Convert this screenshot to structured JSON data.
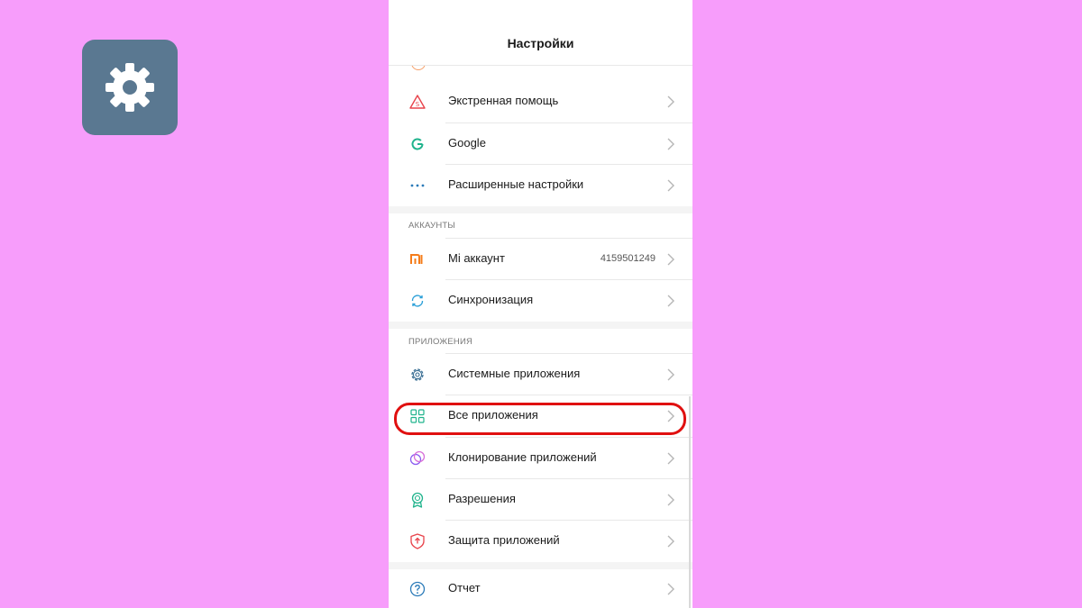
{
  "colors": {
    "background": "#f79dfb",
    "app_icon_bg": "#5a7891",
    "highlight": "#e01010",
    "mi_orange": "#f57c19",
    "google_green": "#1fb38c",
    "accent_blue": "#2a7ab8"
  },
  "app_icon": {
    "icon": "gear-icon"
  },
  "header": {
    "title": "Настройки"
  },
  "rows": {
    "emergency": {
      "label": "Экстренная помощь",
      "icon": "sos-icon"
    },
    "google": {
      "label": "Google",
      "icon": "google-icon"
    },
    "advanced": {
      "label": "Расширенные настройки",
      "icon": "more-dots-icon"
    },
    "mi_account": {
      "label": "Mi аккаунт",
      "value": "4159501249",
      "icon": "mi-icon"
    },
    "sync": {
      "label": "Синхронизация",
      "icon": "sync-icon"
    },
    "system_apps": {
      "label": "Системные приложения",
      "icon": "gear-icon"
    },
    "all_apps": {
      "label": "Все приложения",
      "icon": "apps-grid-icon"
    },
    "clone_apps": {
      "label": "Клонирование приложений",
      "icon": "clone-icon"
    },
    "permissions": {
      "label": "Разрешения",
      "icon": "badge-icon"
    },
    "app_protection": {
      "label": "Защита приложений",
      "icon": "shield-icon"
    },
    "report": {
      "label": "Отчет",
      "icon": "help-icon"
    }
  },
  "sections": {
    "accounts": "АККАУНТЫ",
    "apps": "ПРИЛОЖЕНИЯ"
  }
}
